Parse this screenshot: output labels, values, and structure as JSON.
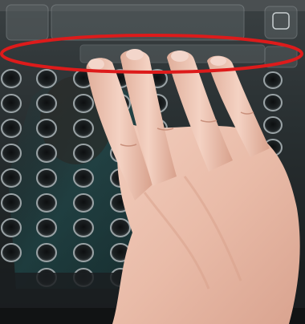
{
  "scene": {
    "subject": "hand-on-touchscreen-with-circular-highlight",
    "highlight_color": "#dd1b1b",
    "screen_color": "#22282a",
    "hole_grid": {
      "columns": 5,
      "rows": 9
    },
    "left_column_visible_rows": 8,
    "right_column_visible_rows": 4
  }
}
